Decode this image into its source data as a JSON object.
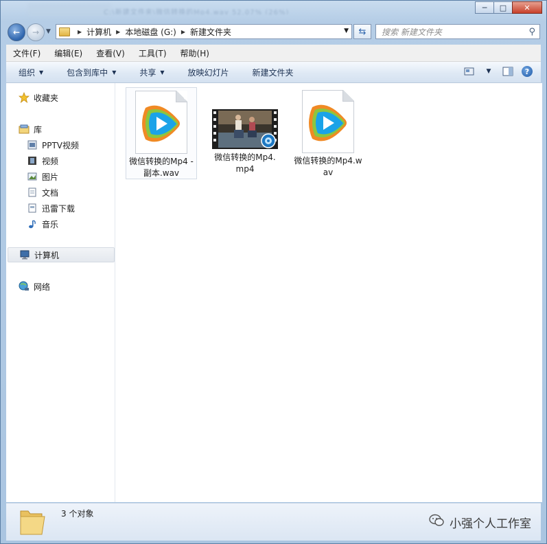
{
  "window": {
    "blurred_title": "C:\\新建文件夹\\微信转换的Mp4.wav  52.07%  (26%)",
    "controls": {
      "minimize": "─",
      "maximize": "□",
      "close": "✕"
    }
  },
  "address": {
    "crumbs": [
      "计算机",
      "本地磁盘 (G:)",
      "新建文件夹"
    ],
    "search_placeholder": "搜索 新建文件夹"
  },
  "menu": [
    "文件(F)",
    "编辑(E)",
    "查看(V)",
    "工具(T)",
    "帮助(H)"
  ],
  "toolbar": {
    "organize": "组织",
    "include_library": "包含到库中",
    "share": "共享",
    "slideshow": "放映幻灯片",
    "new_folder": "新建文件夹"
  },
  "nav": {
    "favorites": "收藏夹",
    "libraries": "库",
    "library_items": [
      "PPTV视频",
      "视频",
      "图片",
      "文档",
      "迅雷下载",
      "音乐"
    ],
    "computer": "计算机",
    "network": "网络"
  },
  "files": [
    {
      "name": "微信转换的Mp4 - 副本.wav",
      "kind": "wav",
      "selected": true
    },
    {
      "name": "微信转换的Mp4.mp4",
      "kind": "video",
      "selected": false
    },
    {
      "name": "微信转换的Mp4.wav",
      "kind": "wav",
      "selected": false
    }
  ],
  "status": {
    "count_text": "3 个对象",
    "watermark": "小强个人工作室"
  },
  "colors": {
    "window_frame": "#aac5e1",
    "selection": "#e4e8ee",
    "player_green": "#8cc63f",
    "player_blue": "#1aa3e8",
    "player_orange": "#f08a24"
  }
}
